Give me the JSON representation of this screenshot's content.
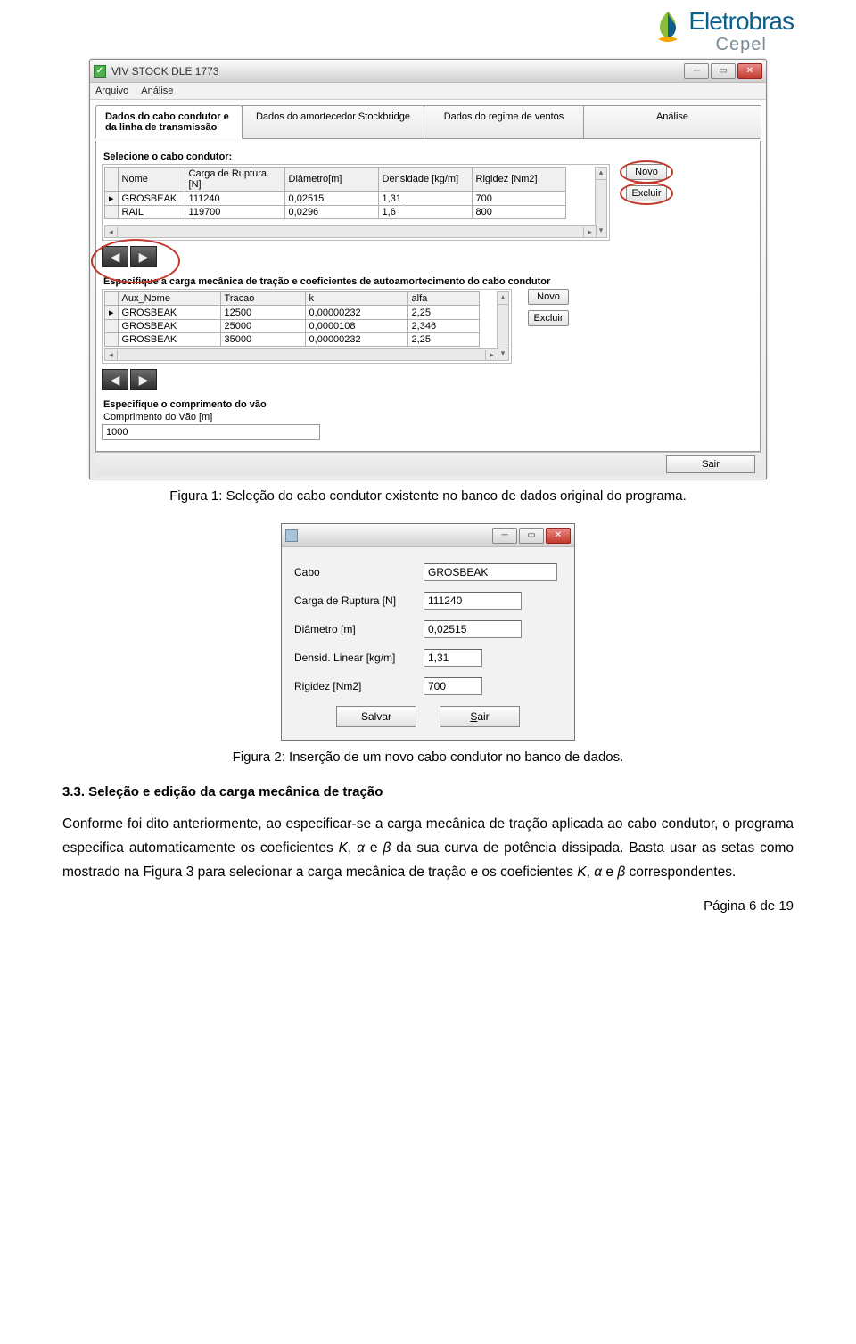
{
  "logo": {
    "brand": "Eletrobras",
    "sub": "Cepel"
  },
  "win1": {
    "title": "VIV STOCK DLE 1773",
    "menu": [
      "Arquivo",
      "Análise"
    ],
    "tabs": [
      "Dados do cabo condutor e da linha de transmissão",
      "Dados do amortecedor Stockbridge",
      "Dados do regime de ventos",
      "Análise"
    ],
    "sec1_label": "Selecione o cabo condutor:",
    "grid1": {
      "headers": [
        "Nome",
        "Carga de Ruptura [N]",
        "Diâmetro[m]",
        "Densidade [kg/m]",
        "Rigidez [Nm2]"
      ],
      "rows": [
        [
          "GROSBEAK",
          "111240",
          "0,02515",
          "1,31",
          "700"
        ],
        [
          "RAIL",
          "119700",
          "0,0296",
          "1,6",
          "800"
        ]
      ]
    },
    "btn_novo": "Novo",
    "btn_excluir": "Excluir",
    "sec2_label": "Especifique a carga mecânica de tração e coeficientes de autoamortecimento do cabo condutor",
    "grid2": {
      "headers": [
        "Aux_Nome",
        "Tracao",
        "k",
        "alfa"
      ],
      "rows": [
        [
          "GROSBEAK",
          "12500",
          "0,00000232",
          "2,25"
        ],
        [
          "GROSBEAK",
          "25000",
          "0,0000108",
          "2,346"
        ],
        [
          "GROSBEAK",
          "35000",
          "0,00000232",
          "2,25"
        ]
      ]
    },
    "sec3_label": "Especifique o comprimento do vão",
    "span_label": "Comprimento do Vão [m]",
    "span_value": "1000",
    "sair": "Sair"
  },
  "caption1": "Figura 1: Seleção do cabo condutor existente no banco de dados original do programa.",
  "dlg": {
    "rows": [
      {
        "label": "Cabo",
        "value": "GROSBEAK",
        "cls": "wide"
      },
      {
        "label": "Carga de Ruptura [N]",
        "value": "111240",
        "cls": ""
      },
      {
        "label": "Diâmetro [m]",
        "value": "0,02515",
        "cls": ""
      },
      {
        "label": "Densid. Linear [kg/m]",
        "value": "1,31",
        "cls": "short"
      },
      {
        "label": "Rigidez [Nm2]",
        "value": "700",
        "cls": "short"
      }
    ],
    "btn_salvar": "Salvar",
    "btn_sair": "Sair"
  },
  "caption2": "Figura 2: Inserção de um novo cabo condutor no banco de dados.",
  "heading": "3.3. Seleção e edição da carga mecânica de tração",
  "para_pre": "Conforme foi dito anteriormente, ao especificar-se a carga mecânica de tração aplicada ao cabo condutor, o programa especifica automaticamente os coeficientes ",
  "para_mid1": "K",
  "para_mid2": "α",
  "para_mid3": "β",
  "para_post1": " da sua curva de potência dissipada. Basta usar as setas como mostrado na Figura 3 para selecionar a carga mecânica de tração e os coeficientes ",
  "para_post2": " correspondentes.",
  "footer": "Página 6 de 19"
}
